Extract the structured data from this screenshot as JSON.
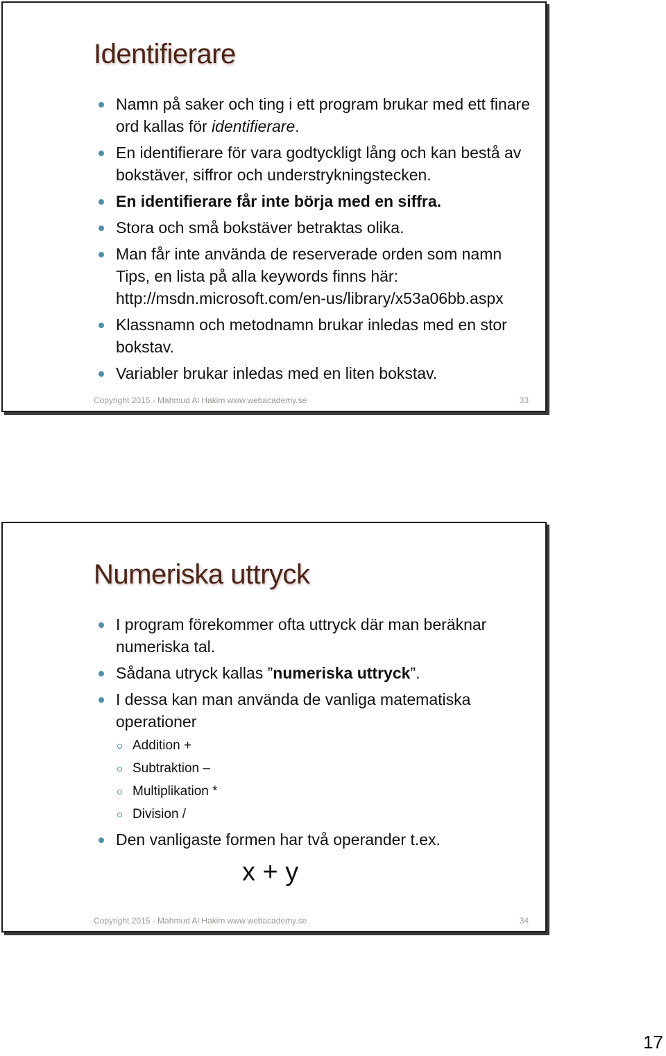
{
  "slides": [
    {
      "title": "Identifierare",
      "bullets": [
        {
          "pre": "Namn på saker och ting i ett program brukar med ett finare ord kallas för ",
          "em": "identifierare",
          "post": ".",
          "bold": false
        },
        {
          "pre": "En identifierare för vara godtyckligt lång och kan bestå av bokstäver, siffror och understrykningstecken.",
          "em": "",
          "post": "",
          "bold": false
        },
        {
          "pre": "En identifierare får inte börja med en siffra.",
          "em": "",
          "post": "",
          "bold": true
        },
        {
          "pre": "Stora och små bokstäver betraktas olika.",
          "em": "",
          "post": "",
          "bold": false
        },
        {
          "pre": "Man får inte använda de reserverade orden som namn Tips, en lista på alla keywords finns här: http://msdn.microsoft.com/en-us/library/x53a06bb.aspx",
          "em": "",
          "post": "",
          "bold": false
        },
        {
          "pre": "Klassnamn och metodnamn brukar inledas med en stor bokstav.",
          "em": "",
          "post": "",
          "bold": false
        },
        {
          "pre": "Variabler brukar inledas med en liten bokstav.",
          "em": "",
          "post": "",
          "bold": false
        }
      ],
      "footer": "Copyright 2015 - Mahmud Al Hakim www.webacademy.se",
      "page": "33"
    },
    {
      "title": "Numeriska uttryck",
      "bullets": [
        {
          "text": "I program förekommer ofta uttryck där man beräknar numeriska tal."
        },
        {
          "pre": "Sådana utryck kallas ”",
          "strong": "numeriska uttryck",
          "post": "”."
        },
        {
          "text": "I dessa kan man använda de vanliga matematiska operationer"
        },
        {
          "text": "Den vanligaste formen har två operander t.ex."
        }
      ],
      "sub_items": [
        "Addition +",
        "Subtraktion –",
        "Multiplikation *",
        "Division /"
      ],
      "expression": "x + y",
      "footer": "Copyright 2015 - Mahmud Al Hakim www.webacademy.se",
      "page": "34"
    }
  ],
  "document_page_number": "17",
  "colors": {
    "title": "#4a2419",
    "bullet": "#4f8fab",
    "footer": "#9a9a92"
  }
}
